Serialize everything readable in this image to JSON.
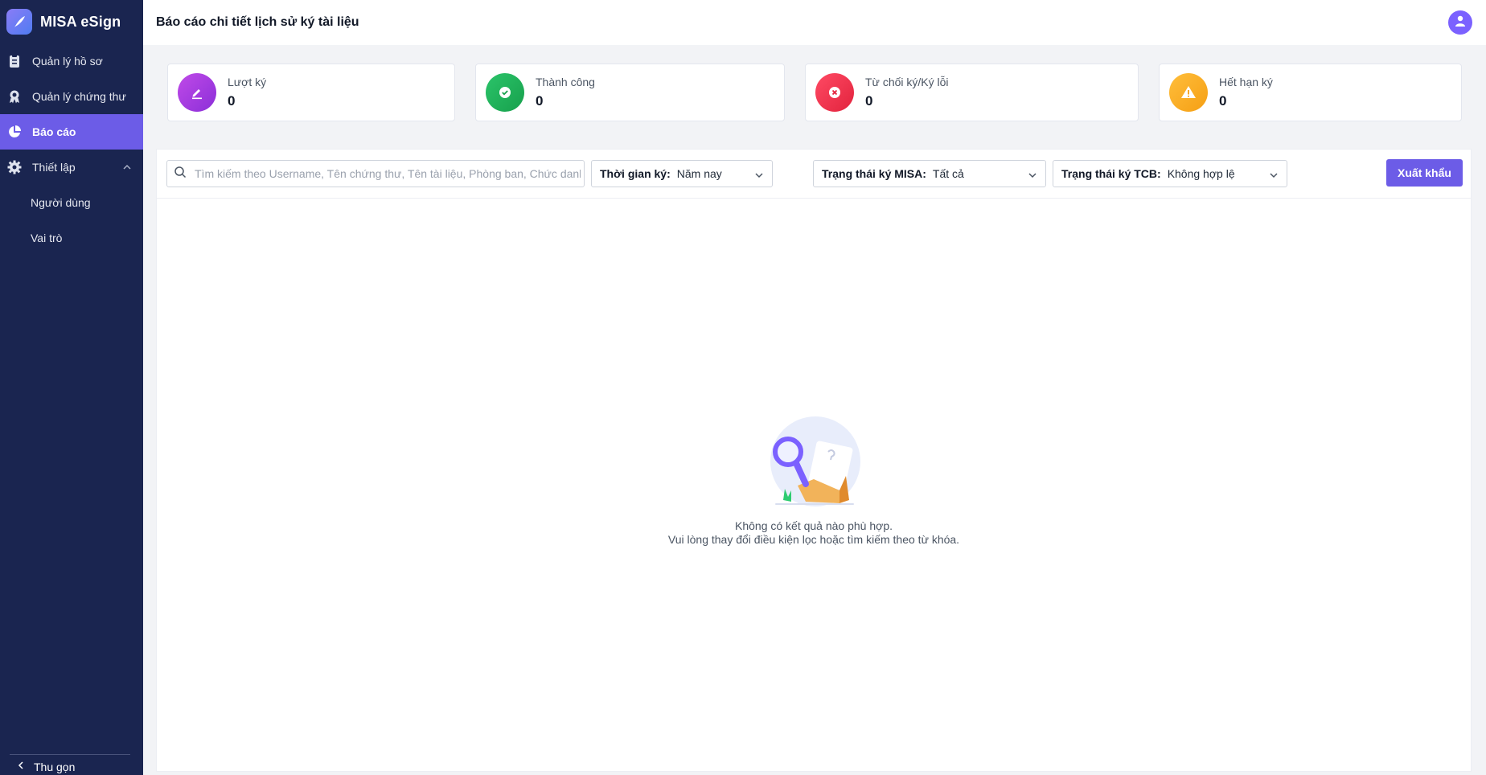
{
  "app": {
    "name": "MISA eSign"
  },
  "sidebar": {
    "items": [
      {
        "label": "Quản lý hồ sơ",
        "icon": "clipboard-icon"
      },
      {
        "label": "Quản lý chứng thư",
        "icon": "certificate-icon"
      },
      {
        "label": "Báo cáo",
        "icon": "pie-chart-icon",
        "active": true
      },
      {
        "label": "Thiết lập",
        "icon": "gear-icon",
        "expanded": true
      }
    ],
    "sub_items": [
      {
        "label": "Người dùng"
      },
      {
        "label": "Vai trò"
      }
    ],
    "collapse_label": "Thu gọn"
  },
  "header": {
    "title": "Báo cáo chi tiết lịch sử ký tài liệu"
  },
  "stats": [
    {
      "label": "Lượt ký",
      "value": "0",
      "icon": "pen-icon",
      "color": "#a43ee0"
    },
    {
      "label": "Thành công",
      "value": "0",
      "icon": "check-icon",
      "color": "#1fb35a"
    },
    {
      "label": "Từ chối ký/Ký lỗi",
      "value": "0",
      "icon": "close-icon",
      "color": "#f0364f"
    },
    {
      "label": "Hết hạn ký",
      "value": "0",
      "icon": "warning-icon",
      "color": "#f5a623"
    }
  ],
  "toolbar": {
    "search_placeholder": "Tìm kiếm theo Username, Tên chứng thư, Tên tài liệu, Phòng ban, Chức danh",
    "filters": [
      {
        "label": "Thời gian ký:",
        "value": "Năm nay"
      },
      {
        "label": "Trạng thái ký MISA:",
        "value": "Tất cả"
      },
      {
        "label": "Trạng thái ký TCB:",
        "value": "Không hợp lệ"
      }
    ],
    "export_label": "Xuất khẩu"
  },
  "empty_state": {
    "line1": "Không có kết quả nào phù hợp.",
    "line2": "Vui lòng thay đổi điều kiện lọc hoặc tìm kiếm theo từ khóa."
  },
  "colors": {
    "sidebar_bg": "#1a2550",
    "accent": "#6c5ce7"
  }
}
